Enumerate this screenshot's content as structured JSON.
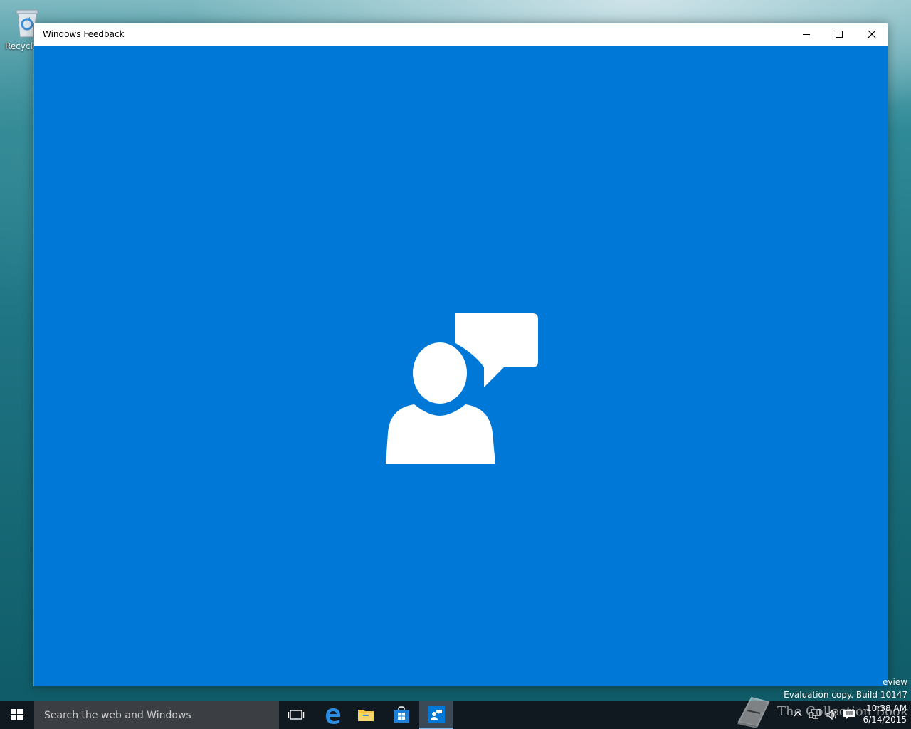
{
  "desktop": {
    "recycle_bin_label": "Recycle"
  },
  "window": {
    "title": "Windows Feedback",
    "controls": {
      "minimize": "minimize-icon",
      "maximize": "maximize-icon",
      "close": "close-icon"
    },
    "splash_icon": "person-with-speech-bubble-icon",
    "background_color": "#0078d7"
  },
  "watermark": {
    "line1": "eview",
    "line2": "Evaluation copy. Build 10147"
  },
  "taskbar": {
    "search_placeholder": "Search the web and Windows",
    "pinned": [
      {
        "name": "task-view-icon"
      },
      {
        "name": "edge-icon"
      },
      {
        "name": "file-explorer-icon"
      },
      {
        "name": "store-icon"
      },
      {
        "name": "windows-feedback-icon"
      }
    ],
    "tray": {
      "time": "10:38 AM",
      "date": "6/14/2015"
    }
  },
  "overlay": {
    "brand": "The Collection Book"
  }
}
